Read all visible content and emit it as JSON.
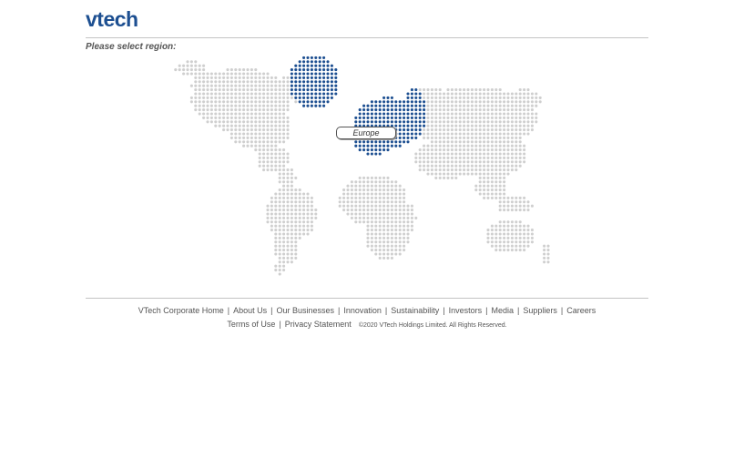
{
  "header": {
    "logo_text": "vtech",
    "brand_color": "#1d4f91"
  },
  "main": {
    "prompt": "Please select region:",
    "map": {
      "dot_color_default": "#cfcfcf",
      "dot_color_selected": "#1d4f91",
      "selected_region_label": "Europe"
    }
  },
  "footer": {
    "links": [
      {
        "label": "VTech Corporate Home"
      },
      {
        "label": "About Us"
      },
      {
        "label": "Our Businesses"
      },
      {
        "label": "Innovation"
      },
      {
        "label": "Sustainability"
      },
      {
        "label": "Investors"
      },
      {
        "label": "Media"
      },
      {
        "label": "Suppliers"
      },
      {
        "label": "Careers"
      }
    ],
    "separator": "|",
    "legal_links": [
      {
        "label": "Terms of Use"
      },
      {
        "label": "Privacy Statement"
      }
    ],
    "copyright": "©2020 VTech Holdings Limited. All Rights Reserved."
  }
}
